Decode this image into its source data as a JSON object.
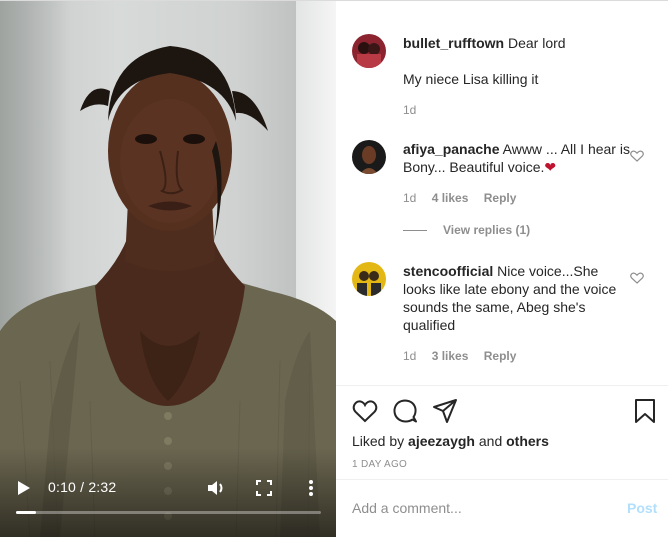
{
  "video": {
    "time": "0:10 / 2:32",
    "progress": 0.066,
    "icons": {
      "play": "play-icon",
      "volume": "volume-icon",
      "fullscreen": "fullscreen-icon",
      "more": "more-vertical-icon"
    }
  },
  "comments": [
    {
      "username": "bullet_rufftown",
      "text": "Dear lord",
      "reply": "My niece Lisa killing it",
      "age": "1d"
    },
    {
      "username": "afiya_panache",
      "text": "Awww ... All I hear is Bony... Beautiful voice.",
      "emoji": "❤",
      "age": "1d",
      "likes": "4 likes",
      "reply_label": "Reply",
      "view_replies": "View replies (1)"
    },
    {
      "username": "stencoofficial",
      "text": "Nice voice...She looks like late ebony and the voice sounds the same, Abeg she's qualified",
      "age": "1d",
      "likes": "3 likes",
      "reply_label": "Reply"
    }
  ],
  "actions": {
    "liked_prefix": "Liked by",
    "liked_user": "ajeezaygh",
    "liked_and": "and",
    "liked_others": "others",
    "date": "1 DAY AGO",
    "icons": {
      "like": "heart-icon",
      "comment": "comment-icon",
      "share": "share-icon",
      "save": "bookmark-icon"
    }
  },
  "add_comment": {
    "placeholder": "Add a comment...",
    "post_label": "Post"
  },
  "colors": {
    "link_disabled": "#b2dffc",
    "heart": "#c0132f",
    "muted": "#8e8e8e",
    "text": "#262626"
  }
}
